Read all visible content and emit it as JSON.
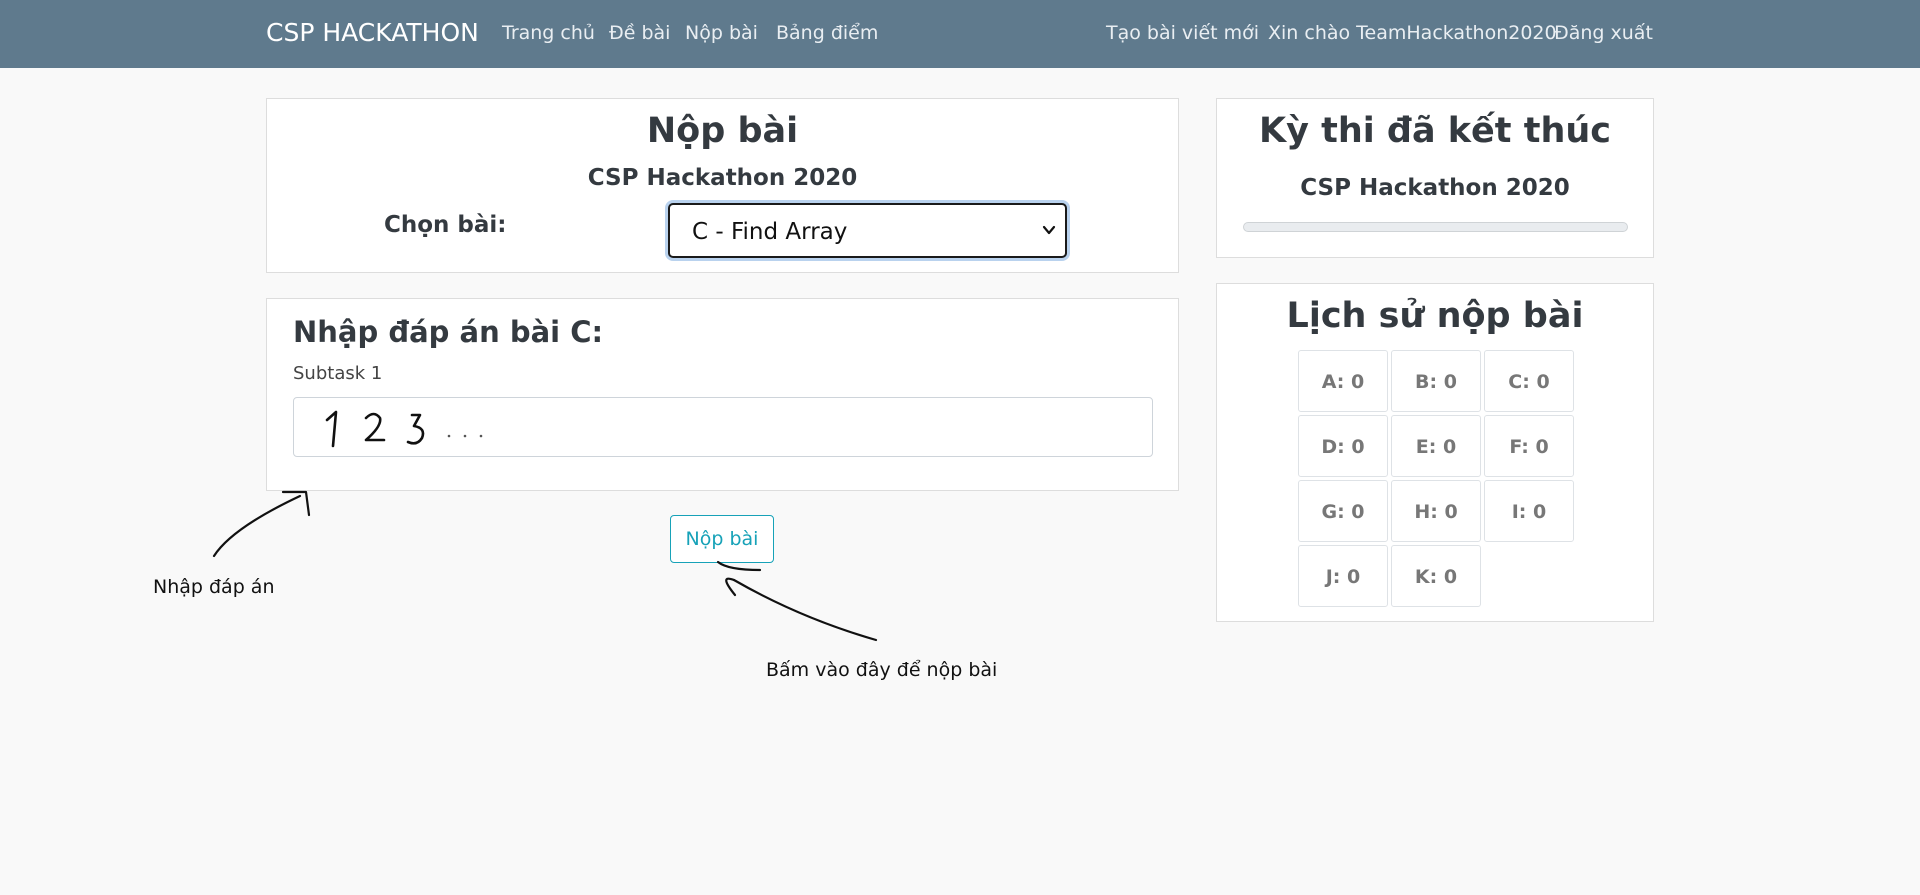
{
  "nav": {
    "brand": "CSP HACKATHON",
    "links": [
      "Trang chủ",
      "Đề bài",
      "Nộp bài",
      "Bảng điểm"
    ],
    "right_links": [
      "Tạo bài viết mới",
      "Xin chào TeamHackathon2020",
      "Đăng xuất"
    ]
  },
  "submit_card": {
    "title": "Nộp bài",
    "contest": "CSP Hackathon 2020",
    "choose_label": "Chọn bài:",
    "selected_problem": "C - Find Array"
  },
  "answer_card": {
    "title": "Nhập đáp án bài C:",
    "subtask_label": "Subtask 1",
    "submit_label": "Nộp bài"
  },
  "annotations": {
    "enter_answer": "Nhập đáp án",
    "click_submit": "Bấm vào đây để nộp bài"
  },
  "status_card": {
    "title": "Kỳ thi đã kết thúc",
    "contest": "CSP Hackathon 2020",
    "progress": 0
  },
  "history": {
    "title": "Lịch sử nộp bài",
    "items": [
      "A: 0",
      "B: 0",
      "C: 0",
      "D: 0",
      "E: 0",
      "F: 0",
      "G: 0",
      "H: 0",
      "I: 0",
      "J: 0",
      "K: 0"
    ]
  },
  "colors": {
    "navbar": "#5f7a8d",
    "accent": "#17a2b8",
    "background": "#f9f9f9"
  }
}
